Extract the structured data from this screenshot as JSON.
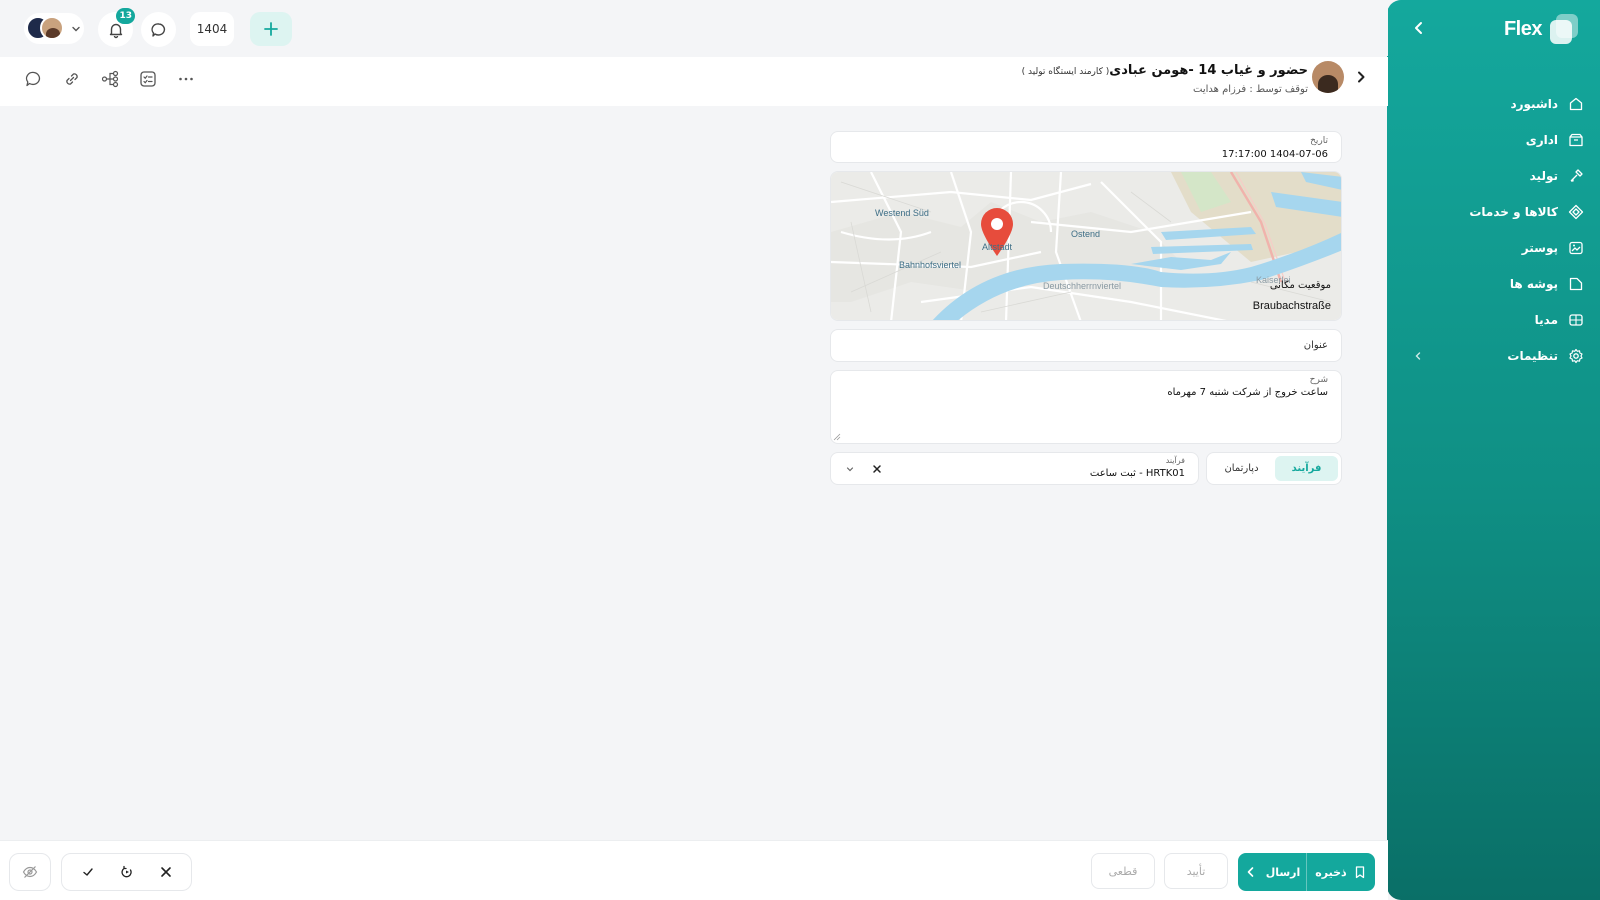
{
  "sidebar": {
    "brand": "Flex",
    "items": [
      {
        "label": "داشبورد",
        "icon": "home-icon"
      },
      {
        "label": "اداری",
        "icon": "box-icon"
      },
      {
        "label": "تولید",
        "icon": "tool-icon"
      },
      {
        "label": "کالاها و خدمات",
        "icon": "diamond-grid-icon"
      },
      {
        "label": "پوستر",
        "icon": "image-icon"
      },
      {
        "label": "پوشه ها",
        "icon": "folder-icon"
      },
      {
        "label": "مدیا",
        "icon": "media-icon"
      },
      {
        "label": "تنظیمات",
        "icon": "gear-icon"
      }
    ]
  },
  "topbar": {
    "notification_count": "13",
    "year": "1404"
  },
  "header": {
    "title": "حضور و غیاب 14 -هومن عبادی",
    "role": "( کارمند ایستگاه تولید )",
    "subtitle": "توقف توسط : فرزام هدایت"
  },
  "form": {
    "date_label": "تاریخ",
    "date_value": "1404-07-06 17:17:00",
    "location_label": "موقعیت مکانی",
    "location_value": "Braubachstraße",
    "map_labels": [
      "Westend Süd",
      "Altstadt",
      "Ostend",
      "Bahnhofsviertel",
      "Deutschherrnviertel",
      "Kaiserlei"
    ],
    "title_placeholder": "عنوان",
    "description_label": "شرح",
    "description_value": "ساعت خروج از شرکت  شنبه 7 مهرماه",
    "segment_process": "فرآیند",
    "segment_department": "دپارتمان",
    "process_label": "فرآیند",
    "process_value": "HRTK01 - ثبت ساعت"
  },
  "bottombar": {
    "final_label": "قطعی",
    "approve_label": "تأیید",
    "send_label": "ارسال",
    "save_label": "ذخیره"
  },
  "colors": {
    "accent": "#14a89d",
    "accent_light": "#ddf4f1"
  }
}
